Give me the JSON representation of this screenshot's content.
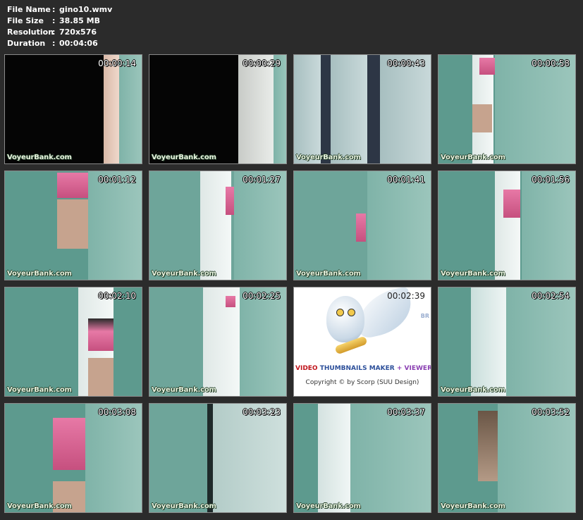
{
  "info": {
    "rows": [
      {
        "label": "File Name",
        "value": "gino10.wmv"
      },
      {
        "label": "File Size",
        "value": "38.85 MB"
      },
      {
        "label": "Resolution",
        "value": "720x576"
      },
      {
        "label": "Duration",
        "value": "00:04:06"
      }
    ]
  },
  "watermark": "VoyeurBank.com",
  "thumbnails": [
    {
      "time": "00:00:14"
    },
    {
      "time": "00:00:29"
    },
    {
      "time": "00:00:43"
    },
    {
      "time": "00:00:58"
    },
    {
      "time": "00:01:12"
    },
    {
      "time": "00:01:27"
    },
    {
      "time": "00:01:41"
    },
    {
      "time": "00:01:56"
    },
    {
      "time": "00:02:10"
    },
    {
      "time": "00:02:25"
    },
    {
      "time": "00:02:39"
    },
    {
      "time": "00:02:54"
    },
    {
      "time": "00:03:08"
    },
    {
      "time": "00:03:23"
    },
    {
      "time": "00:03:37"
    },
    {
      "time": "00:03:52"
    }
  ],
  "logo": {
    "title_part1": "VIDEO",
    "title_part2": "THUMBNAILS MAKER",
    "title_plus": "+",
    "title_part3": "VIEWER",
    "copyright": "Copyright © by Scorp (SUU Design)",
    "corner_text": "BR"
  }
}
